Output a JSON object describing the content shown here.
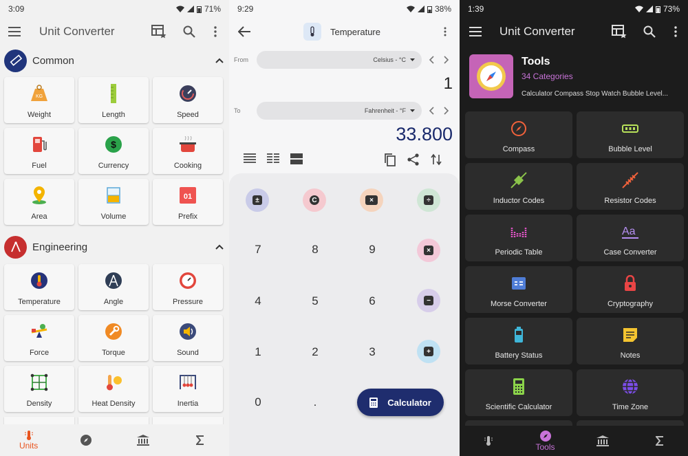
{
  "units_screen": {
    "status": {
      "time": "3:09",
      "battery": "71%"
    },
    "title": "Unit Converter",
    "sections": [
      {
        "title": "Common",
        "items": [
          "Weight",
          "Length",
          "Speed",
          "Fuel",
          "Currency",
          "Cooking",
          "Area",
          "Volume",
          "Prefix"
        ]
      },
      {
        "title": "Engineering",
        "items": [
          "Temperature",
          "Angle",
          "Pressure",
          "Force",
          "Torque",
          "Sound",
          "Density",
          "Heat Density",
          "Inertia"
        ]
      }
    ],
    "weight_icon_text": "KG",
    "prefix_icon_text": "01",
    "nav": {
      "units": "Units"
    },
    "colors": {
      "accent": "#e8541e",
      "common_badge": "#20357c",
      "engineering_badge": "#c62f2f"
    }
  },
  "converter_screen": {
    "status": {
      "time": "9:29",
      "battery": "38%"
    },
    "title": "Temperature",
    "from_label": "From",
    "from_unit": "Celsius - °C",
    "from_value": "1",
    "to_label": "To",
    "to_unit": "Fahrenheit - °F",
    "to_value": "33.800",
    "keys": [
      "7",
      "8",
      "9",
      "4",
      "5",
      "6",
      "1",
      "2",
      "3",
      "0",
      "."
    ],
    "calculator_button": "Calculator",
    "colors": {
      "result": "#1a2a6c",
      "calc_button": "#1f2d6e"
    }
  },
  "tools_screen": {
    "status": {
      "time": "1:39",
      "battery": "73%"
    },
    "title": "Unit Converter",
    "header": {
      "title": "Tools",
      "subtitle": "34 Categories",
      "description": "Calculator Compass Stop Watch Bubble Level..."
    },
    "items": [
      "Compass",
      "Bubble Level",
      "Inductor Codes",
      "Resistor Codes",
      "Periodic Table",
      "Case Converter",
      "Morse Converter",
      "Cryptography",
      "Battery Status",
      "Notes",
      "Scientific Calculator",
      "Time Zone"
    ],
    "nav": {
      "tools": "Tools"
    },
    "colors": {
      "accent": "#c873d8"
    }
  }
}
